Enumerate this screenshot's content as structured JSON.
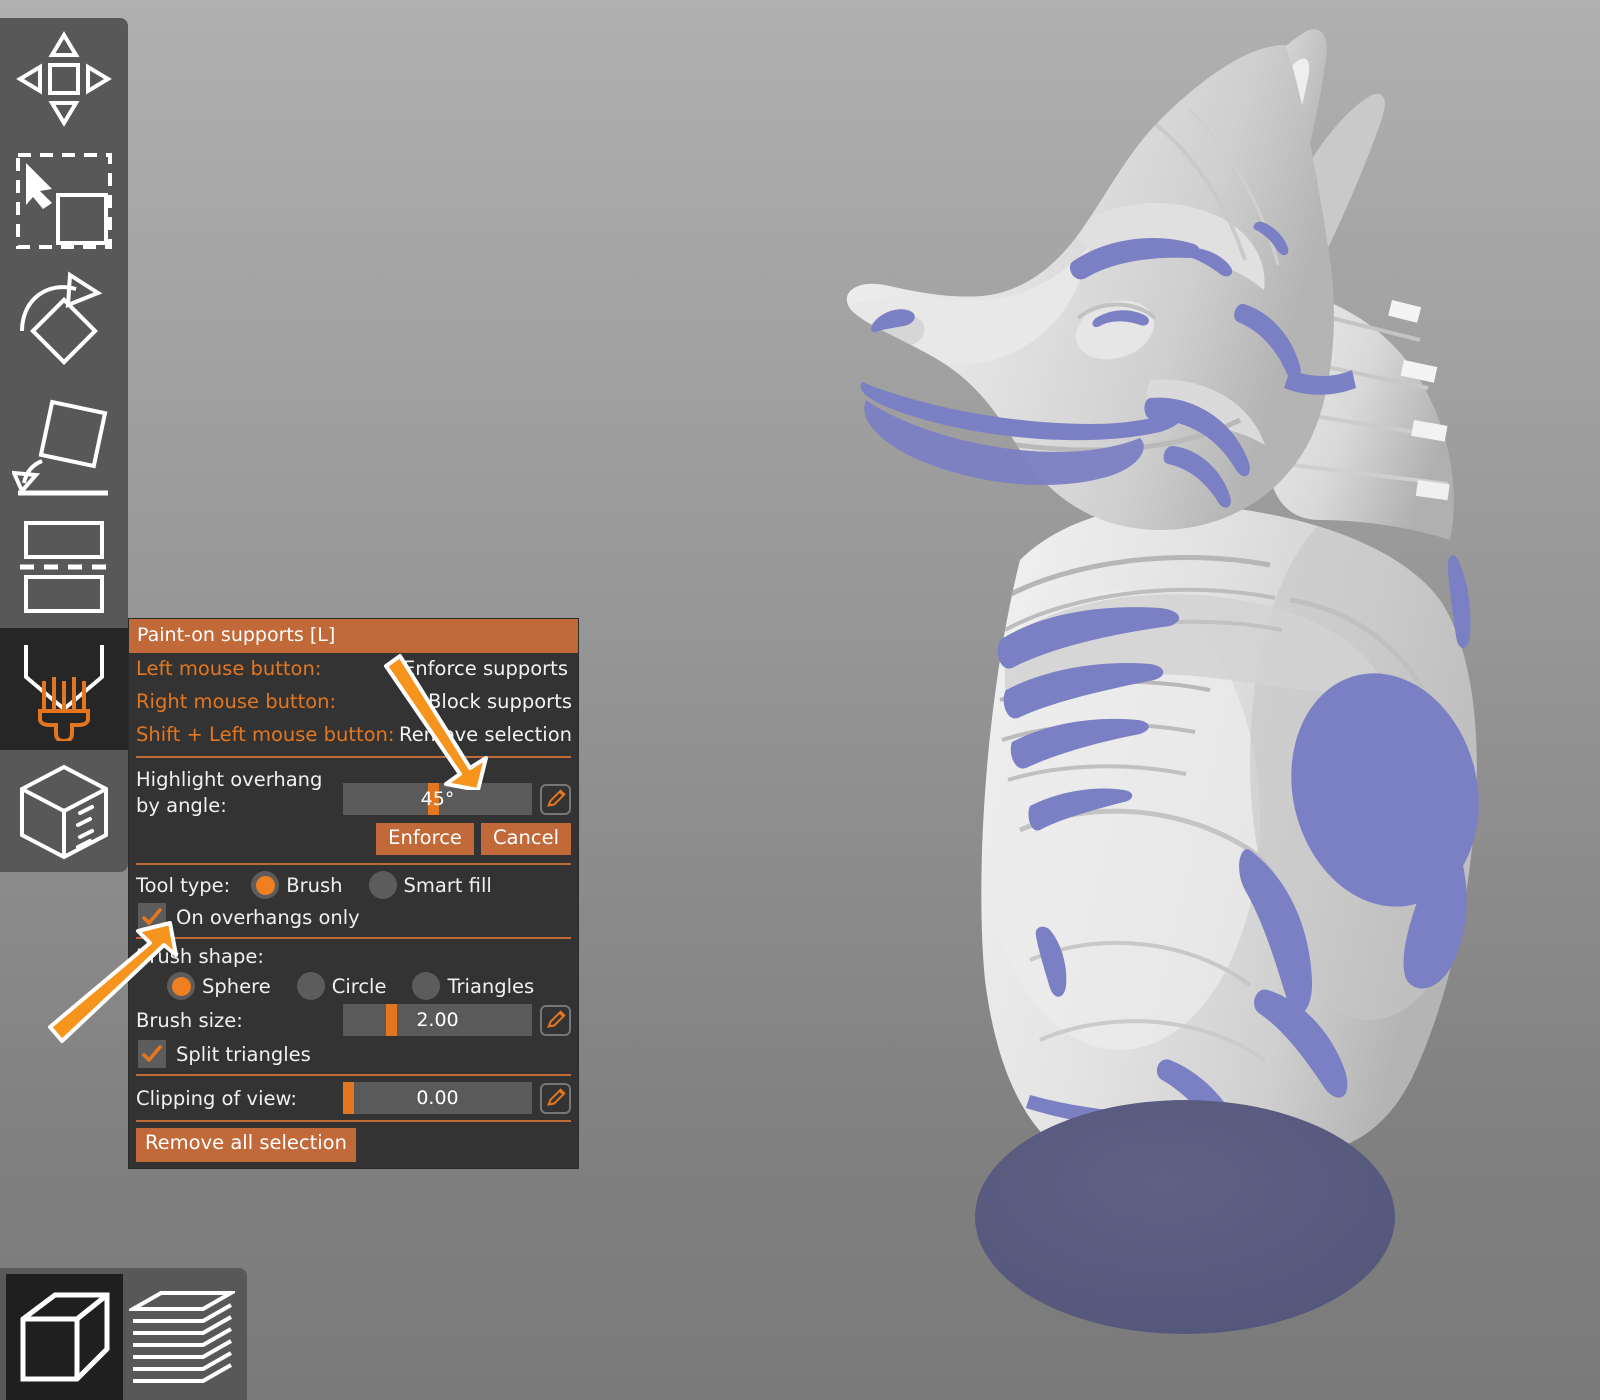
{
  "app": {
    "name": "3D model slicer viewport",
    "background_top": "#b0b0b0",
    "background_bottom": "#7a7a7a"
  },
  "left_toolbar": {
    "items": [
      {
        "icon": "move-arrows-icon",
        "label": "Move",
        "active": false
      },
      {
        "icon": "scale-selection-icon",
        "label": "Scale",
        "active": false
      },
      {
        "icon": "rotate-icon",
        "label": "Rotate",
        "active": false
      },
      {
        "icon": "place-on-face-icon",
        "label": "Place on face",
        "active": false
      },
      {
        "icon": "cut-icon",
        "label": "Cut",
        "active": false
      },
      {
        "icon": "paint-brush-support-icon",
        "label": "Paint-on supports",
        "active": true
      },
      {
        "icon": "seam-cube-icon",
        "label": "Seam painting",
        "active": false
      }
    ]
  },
  "view_toggle": {
    "items": [
      {
        "icon": "solid-cube-icon",
        "label": "3D editor view",
        "active": true
      },
      {
        "icon": "layers-stack-icon",
        "label": "Preview",
        "active": false
      }
    ]
  },
  "panel": {
    "title": "Paint-on supports [L]",
    "accent_color": "#c2693a",
    "background_color": "#333333",
    "hints": [
      {
        "key": "Left mouse button:",
        "value": "Enforce supports"
      },
      {
        "key": "Right mouse button:",
        "value": "Block supports"
      },
      {
        "key": "Shift + Left mouse button:",
        "value": "Remove selection"
      }
    ],
    "highlight_overhang": {
      "label": "Highlight overhang\nby angle:",
      "value": "45°",
      "slider_percent": 45,
      "edit_icon": "pencil-edit-icon"
    },
    "enforce_button": "Enforce",
    "cancel_button": "Cancel",
    "tool_type": {
      "label": "Tool type:",
      "options": [
        {
          "label": "Brush",
          "selected": true
        },
        {
          "label": "Smart fill",
          "selected": false
        }
      ]
    },
    "on_overhangs_only": {
      "label": "On overhangs only",
      "checked": true
    },
    "brush_shape": {
      "label": "Brush shape:",
      "options": [
        {
          "label": "Sphere",
          "selected": true
        },
        {
          "label": "Circle",
          "selected": false
        },
        {
          "label": "Triangles",
          "selected": false
        }
      ]
    },
    "brush_size": {
      "label": "Brush size:",
      "value": "2.00",
      "slider_percent": 23,
      "edit_icon": "pencil-edit-icon"
    },
    "split_triangles": {
      "label": "Split triangles",
      "checked": true
    },
    "clipping_of_view": {
      "label": "Clipping of view:",
      "value": "0.00",
      "slider_percent": 2,
      "edit_icon": "pencil-edit-icon"
    },
    "remove_all_button": "Remove all selection"
  },
  "model": {
    "name": "Anubis jackal bust",
    "surface_color": "#dcdcdc",
    "overhang_highlight_color": "#7b7fc4",
    "base_disc_color": "#585a7d"
  },
  "annotations": [
    {
      "name": "arrow-to-angle-slider",
      "color": "#f7941e",
      "points_at": "highlight-overhang-slider"
    },
    {
      "name": "arrow-to-overhangs-checkbox",
      "color": "#f7941e",
      "points_at": "on-overhangs-only-checkbox"
    }
  ]
}
